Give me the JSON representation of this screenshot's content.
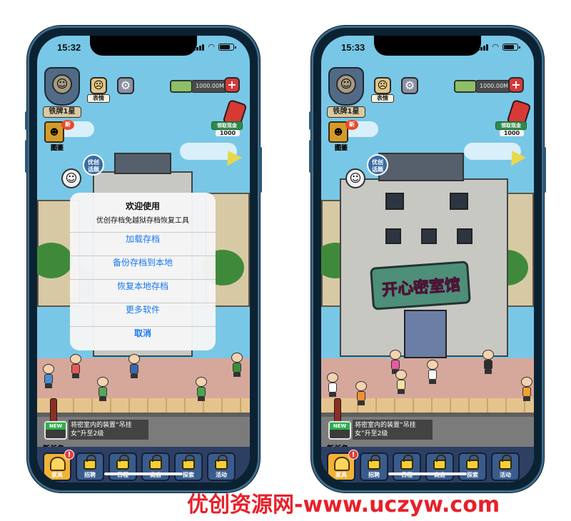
{
  "left_phone": {
    "status": {
      "time": "15:32"
    },
    "hud": {
      "rank_label": "铁牌1星",
      "emoji_label": "表情",
      "money": "1000.00M",
      "plus": "+",
      "ad_label": "领取现金",
      "ad_value": "1000",
      "book_label": "图鉴",
      "tour_label": "优创 话题"
    },
    "task": {
      "new_badge": "NEW",
      "text": "将密室内的装置“吊挂女”升至2级",
      "title": "新任务"
    },
    "tabs": [
      {
        "label": "家具"
      },
      {
        "label": "招聘"
      },
      {
        "label": "日程"
      },
      {
        "label": "商店"
      },
      {
        "label": "探索"
      },
      {
        "label": "活动"
      }
    ],
    "alert": {
      "title": "欢迎使用",
      "message": "优创存档免越狱存档恢复工具",
      "buttons": [
        "加载存档",
        "备份存档到本地",
        "恢复本地存档",
        "更多软件"
      ],
      "cancel": "取消"
    }
  },
  "right_phone": {
    "status": {
      "time": "15:33"
    },
    "hud": {
      "rank_label": "铁牌1星",
      "emoji_label": "表情",
      "money": "1000.00M",
      "plus": "+",
      "ad_label": "领取现金",
      "ad_value": "1000",
      "book_label": "图鉴",
      "tour_label": "优创 话题"
    },
    "sign_text": "开心密室馆",
    "task": {
      "new_badge": "NEW",
      "text": "将密室内的装置“吊挂女”升至2级",
      "title": "新任务"
    },
    "tabs": [
      {
        "label": "家具"
      },
      {
        "label": "招聘"
      },
      {
        "label": "日程"
      },
      {
        "label": "商店"
      },
      {
        "label": "探索"
      },
      {
        "label": "活动"
      }
    ]
  },
  "watermark": "优创资源网-www.uczyw.com",
  "colors": {
    "phone_frame": "#0b2233",
    "sky": "#79c7e6",
    "alert_action": "#1778f2",
    "watermark": "#e8202a"
  },
  "icons": [
    "signal-icon",
    "wifi-icon",
    "battery-icon",
    "gear-icon",
    "plus-icon",
    "lock-icon",
    "book-icon",
    "clown-icon",
    "money-icon",
    "extinguisher-icon"
  ]
}
